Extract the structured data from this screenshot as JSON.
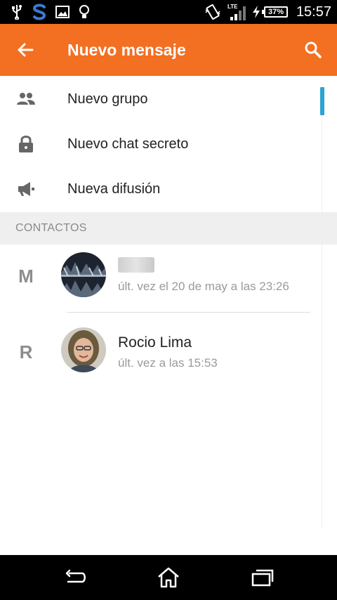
{
  "status_bar": {
    "icons": [
      "usb-icon",
      "app-s-icon",
      "image-icon",
      "bulb-icon",
      "vibrate-icon",
      "lte-signal-icon",
      "charging-icon"
    ],
    "network": "LTE",
    "battery": "37%",
    "time": "15:57"
  },
  "app_bar": {
    "title": "Nuevo mensaje",
    "color": "#f36f21"
  },
  "menu": [
    {
      "label": "Nuevo grupo",
      "icon": "group-icon"
    },
    {
      "label": "Nuevo chat secreto",
      "icon": "lock-icon"
    },
    {
      "label": "Nueva difusión",
      "icon": "megaphone-icon"
    }
  ],
  "section": {
    "title": "CONTACTOS"
  },
  "contacts": [
    {
      "letter": "M",
      "name": "",
      "status": "últ. vez el 20 de may a las 23:26"
    },
    {
      "letter": "R",
      "name": "Rocio Lima",
      "status": "últ. vez a las 15:53"
    }
  ],
  "nav": {
    "buttons": [
      "back-icon",
      "home-icon",
      "recents-icon"
    ]
  }
}
